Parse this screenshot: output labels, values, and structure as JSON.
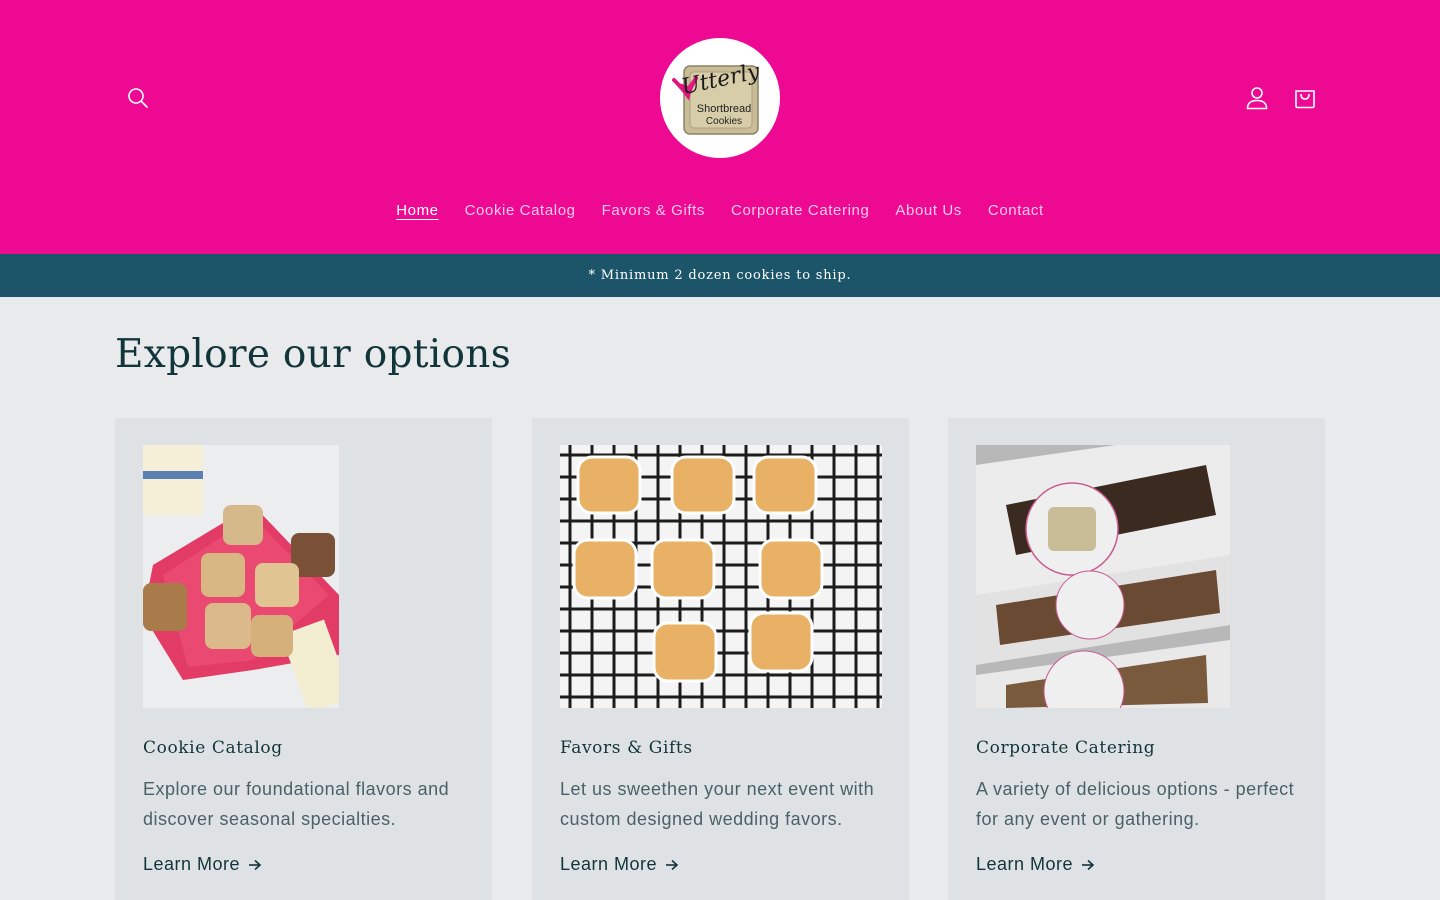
{
  "header": {
    "logo_text": "Utterly Shortbread Cookies",
    "accent_color": "#ee0993"
  },
  "nav": {
    "items": [
      {
        "label": "Home",
        "active": true
      },
      {
        "label": "Cookie Catalog",
        "active": false
      },
      {
        "label": "Favors & Gifts",
        "active": false
      },
      {
        "label": "Corporate Catering",
        "active": false
      },
      {
        "label": "About Us",
        "active": false
      },
      {
        "label": "Contact",
        "active": false
      }
    ]
  },
  "announcement": {
    "text": "* Minimum 2 dozen cookies to ship.",
    "bg_color": "#1c556a"
  },
  "main": {
    "title": "Explore our options",
    "cards": [
      {
        "title": "Cookie Catalog",
        "description": "Explore our foundational flavors and discover seasonal specialties.",
        "link": "Learn More"
      },
      {
        "title": "Favors & Gifts",
        "description": "Let us sweethen your next event with custom designed wedding favors.",
        "link": "Learn More"
      },
      {
        "title": "Corporate Catering",
        "description": "A variety of delicious options - perfect for any event or gathering.",
        "link": "Learn More"
      }
    ]
  },
  "icons": {
    "search": "search-icon",
    "account": "user-icon",
    "cart": "cart-icon",
    "arrow": "arrow-right-icon"
  }
}
